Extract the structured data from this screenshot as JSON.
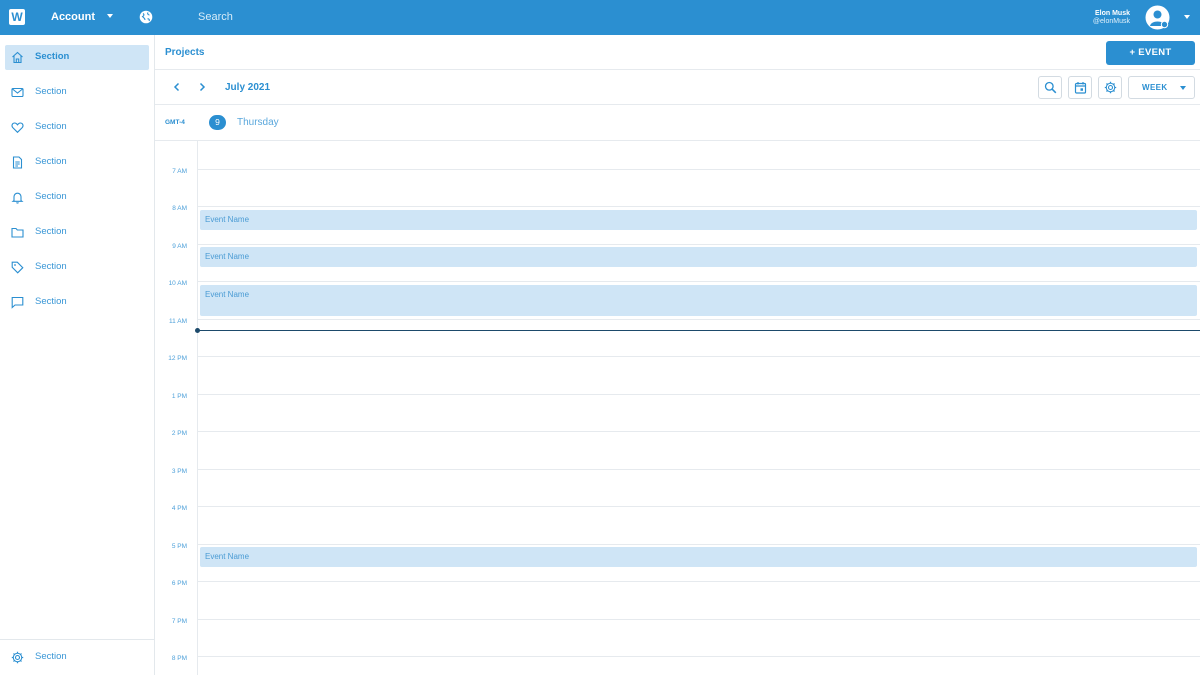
{
  "topbar": {
    "logo": "W",
    "account_label": "Account",
    "search_placeholder": "Search",
    "user_name": "Elon Musk",
    "user_handle": "@elonMusk",
    "icons": [
      "globe-icon",
      "avatar-icon",
      "chevron-down-icon"
    ]
  },
  "sidebar": {
    "items": [
      {
        "label": "Section",
        "icon": "home-icon",
        "active": true
      },
      {
        "label": "Section",
        "icon": "mail-icon"
      },
      {
        "label": "Section",
        "icon": "heart-icon"
      },
      {
        "label": "Section",
        "icon": "document-icon"
      },
      {
        "label": "Section",
        "icon": "bell-icon"
      },
      {
        "label": "Section",
        "icon": "folder-icon"
      },
      {
        "label": "Section",
        "icon": "tag-icon"
      },
      {
        "label": "Section",
        "icon": "chat-icon"
      }
    ],
    "footer": {
      "label": "Section",
      "icon": "gear-icon"
    }
  },
  "header": {
    "title": "Projects",
    "event_button": "+ EVENT",
    "month": "July 2021",
    "view_select": "WEEK"
  },
  "day": {
    "timezone": "GMT-4",
    "date_number": "9",
    "weekday": "Thursday"
  },
  "hours": [
    "7 AM",
    "8 AM",
    "9 AM",
    "10 AM",
    "11 AM",
    "12 PM",
    "1 PM",
    "2 PM",
    "3 PM",
    "4 PM",
    "5 PM",
    "6 PM",
    "7 PM",
    "8 PM"
  ],
  "events": [
    {
      "name": "Event Name"
    },
    {
      "name": "Event Name"
    },
    {
      "name": "Event Name"
    },
    {
      "name": "Event Name"
    }
  ],
  "colors": {
    "brand": "#2b8fd1",
    "event_bg": "#cfe5f6",
    "now_line": "#1d4a6b"
  }
}
